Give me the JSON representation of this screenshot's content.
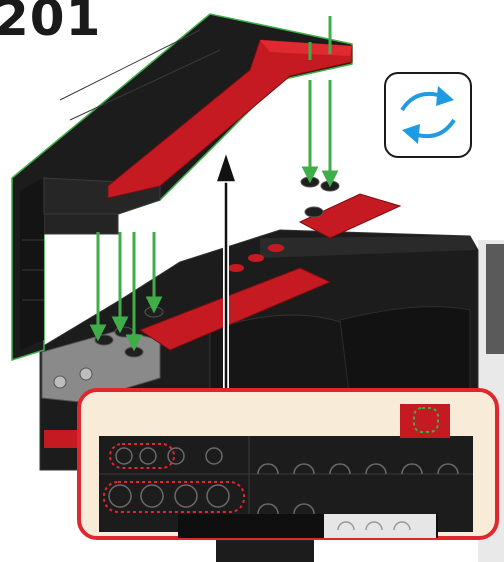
{
  "step": {
    "number": "201"
  },
  "rotate_indicator": {
    "icon": "rotate-model-icon",
    "color": "#1e9be3"
  },
  "colors": {
    "brick_black": "#1c1c1c",
    "brick_dark": "#0f0f0f",
    "brick_red": "#c61a22",
    "brick_gray": "#8a8a8a",
    "guide_green": "#3fae49",
    "callout_border": "#e0262e",
    "callout_bg": "#f8ecd8"
  }
}
